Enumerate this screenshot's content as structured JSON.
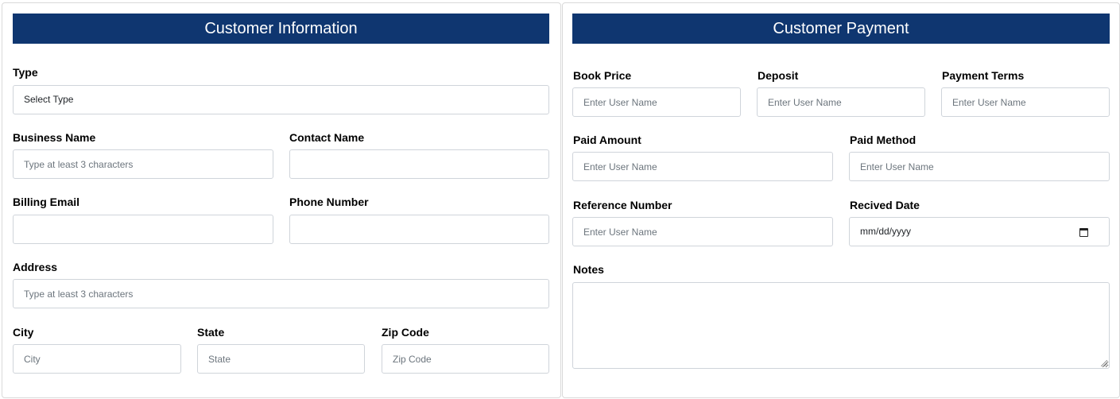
{
  "customer_info": {
    "title": "Customer Information",
    "type": {
      "label": "Type",
      "value": "Select Type"
    },
    "business_name": {
      "label": "Business Name",
      "placeholder": "Type at least 3 characters"
    },
    "contact_name": {
      "label": "Contact Name",
      "placeholder": ""
    },
    "billing_email": {
      "label": "Billing Email",
      "placeholder": ""
    },
    "phone_number": {
      "label": "Phone Number",
      "placeholder": ""
    },
    "address": {
      "label": "Address",
      "placeholder": "Type at least 3 characters"
    },
    "city": {
      "label": "City",
      "placeholder": "City"
    },
    "state": {
      "label": "State",
      "placeholder": "State"
    },
    "zip_code": {
      "label": "Zip Code",
      "placeholder": "Zip Code"
    }
  },
  "customer_payment": {
    "title": "Customer Payment",
    "book_price": {
      "label": "Book Price",
      "placeholder": "Enter User Name"
    },
    "deposit": {
      "label": "Deposit",
      "placeholder": "Enter User Name"
    },
    "payment_terms": {
      "label": "Payment Terms",
      "placeholder": "Enter User Name"
    },
    "paid_amount": {
      "label": "Paid Amount",
      "placeholder": "Enter User Name"
    },
    "paid_method": {
      "label": "Paid Method",
      "placeholder": "Enter User Name"
    },
    "reference_number": {
      "label": "Reference Number",
      "placeholder": "Enter User Name"
    },
    "received_date": {
      "label": "Recived Date",
      "value": "mm/dd/yyyy",
      "icon": "calendar-icon"
    },
    "notes": {
      "label": "Notes",
      "placeholder": ""
    }
  },
  "colors": {
    "header_bg": "#0f3670",
    "header_text": "#ffffff",
    "border": "#cfd4da"
  }
}
